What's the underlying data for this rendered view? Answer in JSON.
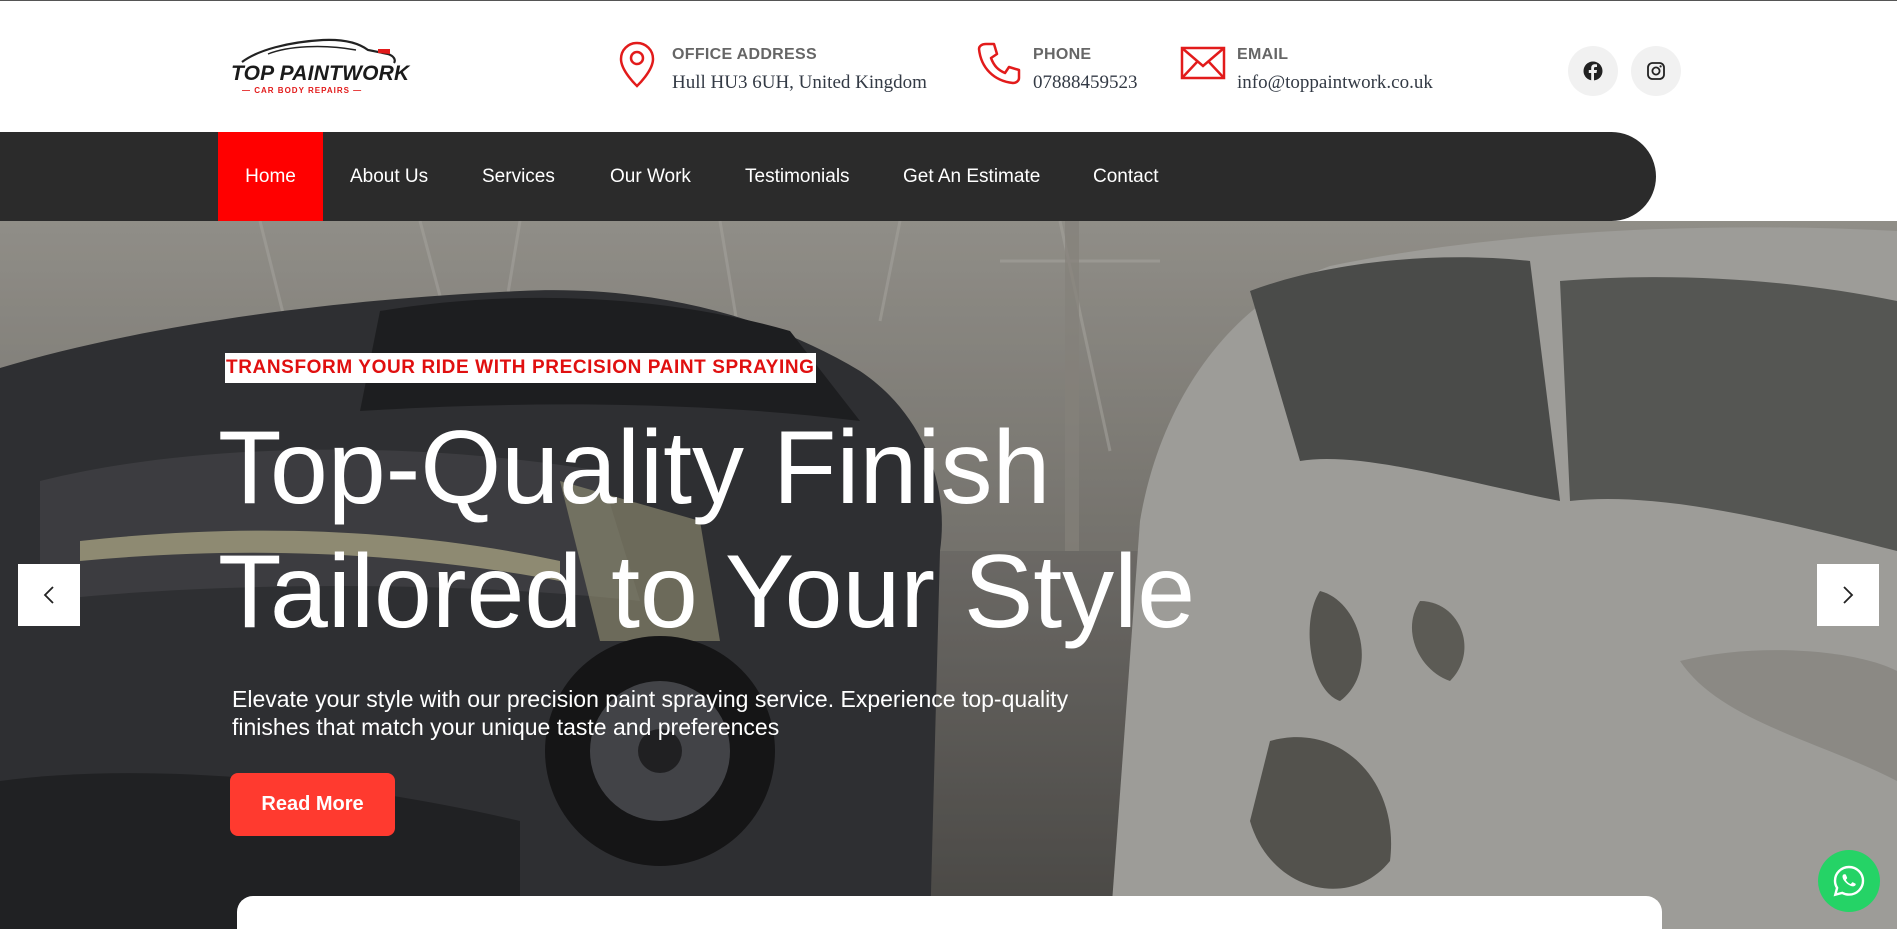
{
  "logo": {
    "name": "TOP PAINTWORK",
    "tagline": "CAR BODY REPAIRS"
  },
  "contact": {
    "address": {
      "label": "OFFICE ADDRESS",
      "value": "Hull HU3 6UH, United Kingdom",
      "icon": "map-pin-icon"
    },
    "phone": {
      "label": "PHONE",
      "value": "07888459523",
      "icon": "phone-icon"
    },
    "email": {
      "label": "EMAIL",
      "value": "info@toppaintwork.co.uk",
      "icon": "mail-icon"
    }
  },
  "social": [
    {
      "icon": "facebook-icon"
    },
    {
      "icon": "instagram-icon"
    }
  ],
  "nav": {
    "items": [
      {
        "label": "Home",
        "active": true
      },
      {
        "label": "About Us"
      },
      {
        "label": "Services"
      },
      {
        "label": "Our Work"
      },
      {
        "label": "Testimonials"
      },
      {
        "label": "Get An Estimate"
      },
      {
        "label": "Contact"
      }
    ]
  },
  "hero": {
    "tagline": "TRANSFORM YOUR RIDE WITH PRECISION PAINT SPRAYING",
    "headline_line1": "Top-Quality Finish",
    "headline_line2": "Tailored to Your Style",
    "description": "Elevate your style with our precision paint spraying service. Experience top-quality finishes that match your unique taste and preferences",
    "button_label": "Read More"
  },
  "colors": {
    "accent": "#ff0000",
    "button": "#ff3a2f",
    "nav_bg": "#2b2b2b",
    "whatsapp": "#25d366"
  }
}
